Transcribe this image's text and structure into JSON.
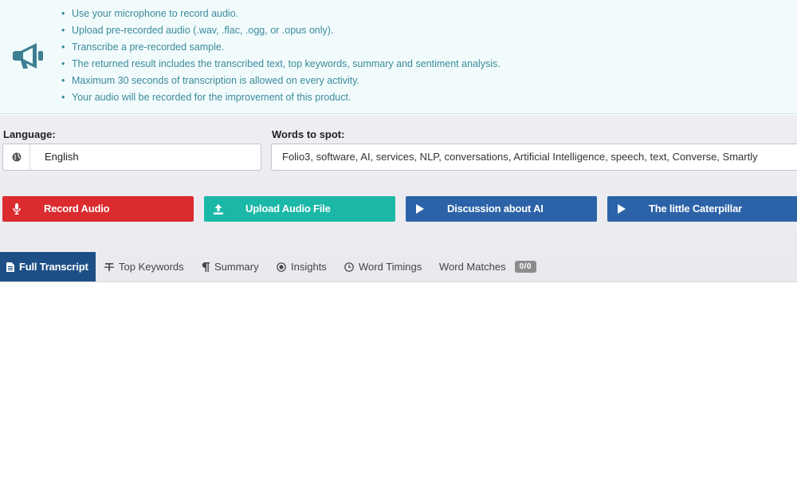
{
  "info": {
    "icon": "megaphone-icon",
    "items": [
      "Use your microphone to record audio.",
      "Upload pre-recorded audio (.wav, .flac, .ogg, or .opus only).",
      "Transcribe a pre-recorded sample.",
      "The returned result includes the transcribed text, top keywords, summary and sentiment analysis.",
      "Maximum 30 seconds of transcription is allowed on every activity.",
      "Your audio will be recorded for the improvement of this product."
    ]
  },
  "language": {
    "label": "Language:",
    "value": "English",
    "icon": "globe-icon"
  },
  "words": {
    "label": "Words to spot:",
    "value": "Folio3, software, AI, services, NLP, conversations, Artificial Intelligence, speech, text, Converse, Smartly"
  },
  "buttons": {
    "record": "Record Audio",
    "upload": "Upload Audio File",
    "sample1": "Discussion about AI",
    "sample2": "The little Caterpillar"
  },
  "tabs": {
    "full_transcript": "Full Transcript",
    "top_keywords": "Top Keywords",
    "summary": "Summary",
    "insights": "Insights",
    "word_timings": "Word Timings",
    "word_matches": "Word Matches",
    "word_matches_badge": "0/0"
  },
  "colors": {
    "record": "#dc2b2f",
    "upload": "#1bb8a8",
    "sample": "#2c63a8",
    "active_tab": "#1d4f86",
    "info_text": "#3a8a9c"
  }
}
